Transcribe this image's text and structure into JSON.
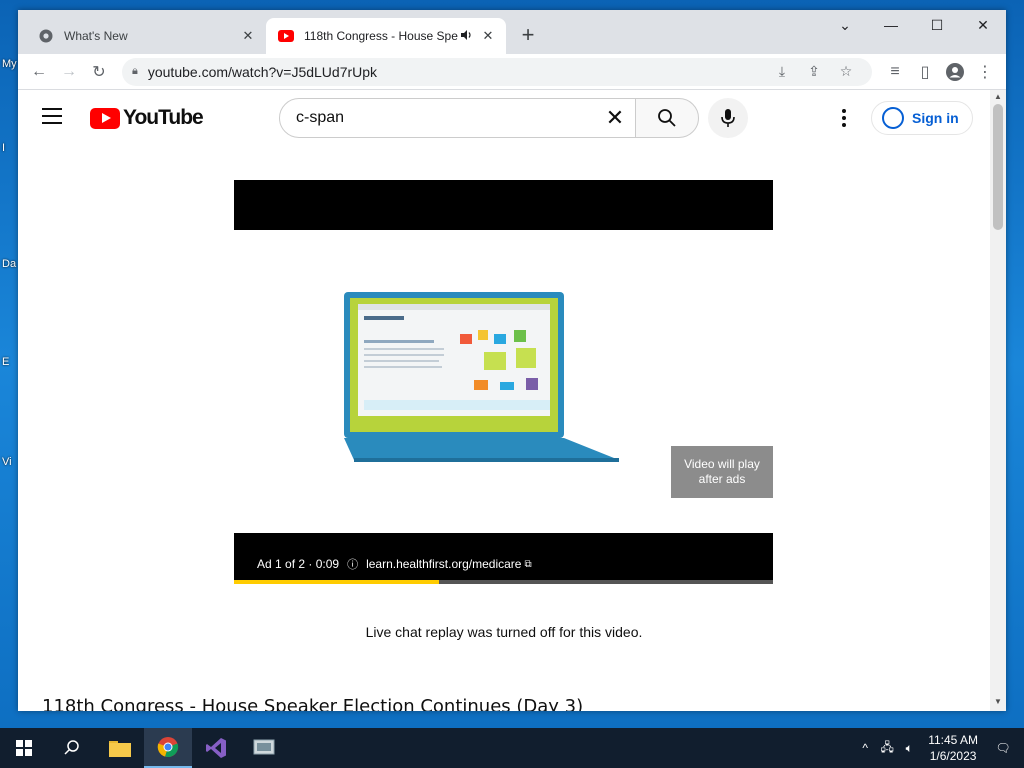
{
  "desktop": {
    "icon_labels": [
      "My",
      "I",
      "Da",
      "E",
      "Vi"
    ]
  },
  "browser": {
    "tabs": [
      {
        "title": "What's New",
        "active": false
      },
      {
        "title": "118th Congress - House Spe",
        "active": true
      }
    ],
    "new_tab_label": "+",
    "address": "youtube.com/watch?v=J5dLUd7rUpk"
  },
  "youtube": {
    "logo_text": "YouTube",
    "search_query": "c-span",
    "sign_in_label": "Sign in",
    "ad": {
      "counter": "Ad 1 of 2 · 0:09",
      "link": "learn.healthfirst.org/medicare",
      "skip_text": "Video will play after ads",
      "progress_percent": 38
    },
    "live_chat_notice": "Live chat replay was turned off for this video.",
    "video_title": "118th Congress - House Speaker Election Continues (Day 3)"
  },
  "taskbar": {
    "time": "11:45 AM",
    "date": "1/6/2023"
  },
  "colors": {
    "accent_blue": "#065fd4",
    "yt_red": "#ff0000",
    "ad_yellow": "#ffcc00"
  }
}
